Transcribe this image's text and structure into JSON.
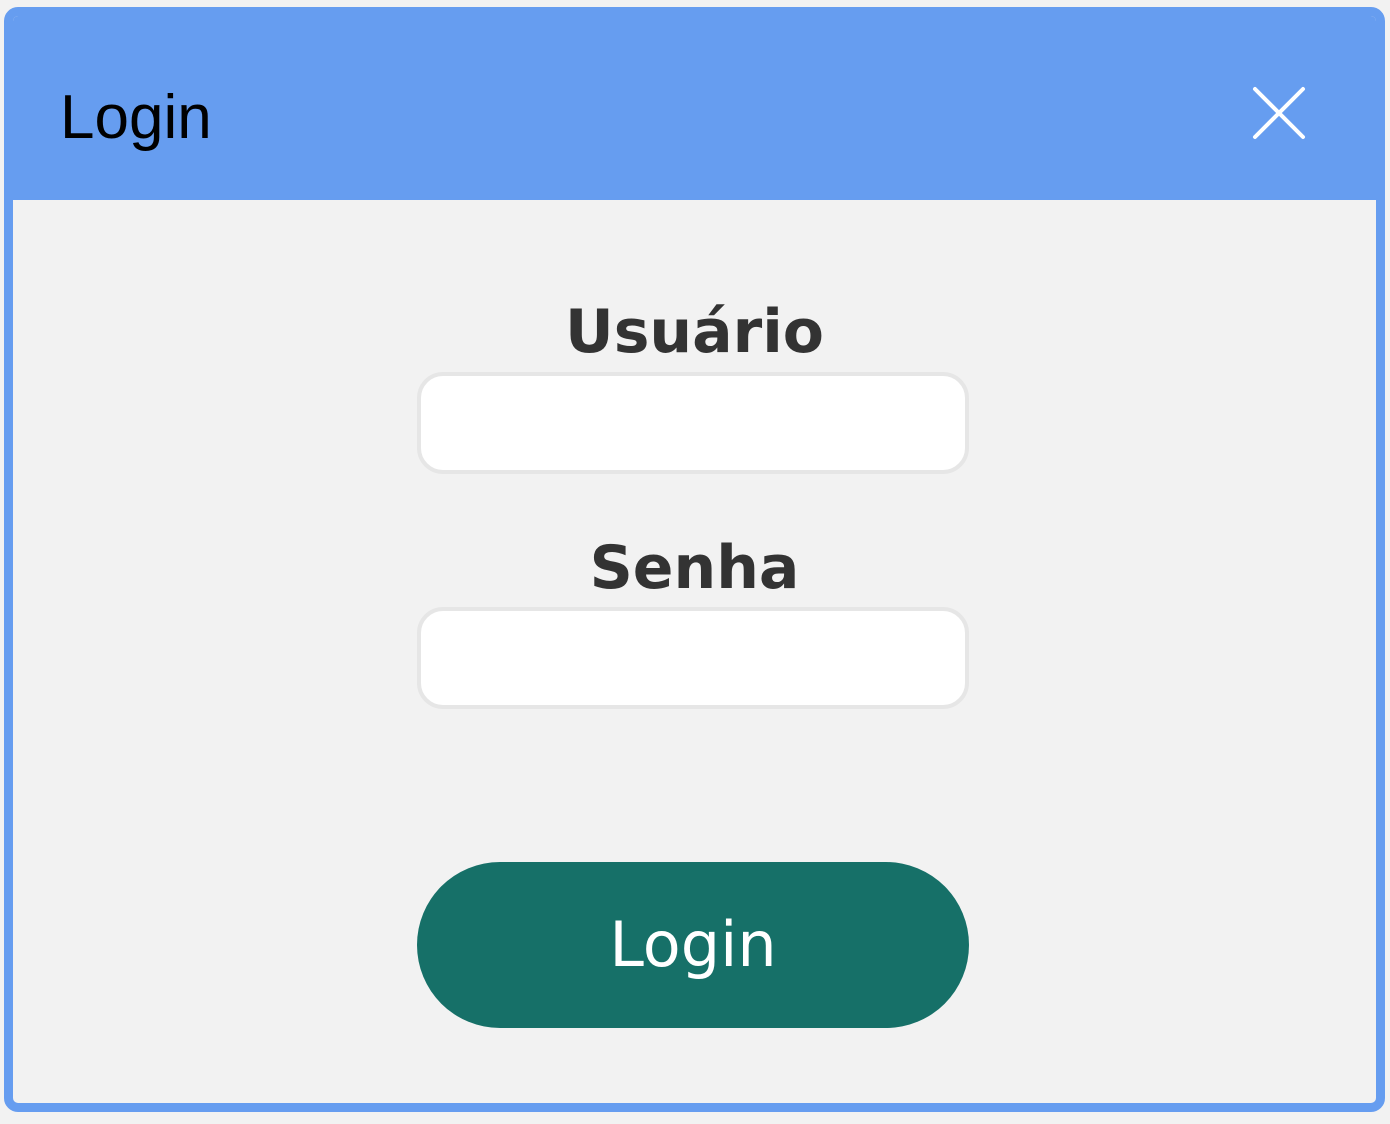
{
  "dialog": {
    "title": "Login",
    "close_icon": "close-icon"
  },
  "form": {
    "username_label": "Usuário",
    "username_value": "",
    "password_label": "Senha",
    "password_value": "",
    "submit_label": "Login"
  },
  "colors": {
    "titlebar": "#669df0",
    "background": "#f2f2f2",
    "button": "#167068",
    "label_text": "#333333"
  }
}
